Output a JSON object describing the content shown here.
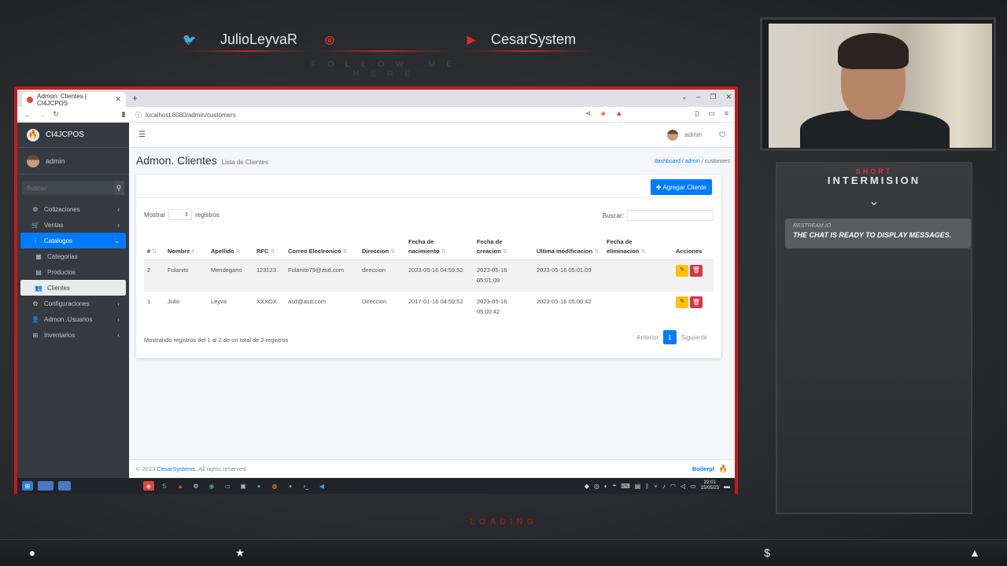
{
  "overlay": {
    "social": [
      {
        "icon": "twitter-icon",
        "handle": "JulioLeyvaR"
      },
      {
        "icon": "instagram-icon",
        "handle": ""
      },
      {
        "icon": "youtube-icon",
        "handle": "CesarSystem"
      }
    ],
    "follow_text": "FOLLOW ME HERE",
    "chat": {
      "title_small": "SHORT",
      "title": "INTERMISION",
      "user": "RESTREAM.IO",
      "message": "THE CHAT IS READY TO DISPLAY MESSAGES."
    },
    "loading_text": "LOADING"
  },
  "browser": {
    "tab_title": "Admon. Clientes | CI4JCPOS",
    "url": "localhost:8080/admin/customers"
  },
  "app": {
    "brand": "CI4JCPOS",
    "user": "admin",
    "sidebar_search_placeholder": "Buscar",
    "menu": [
      {
        "label": "Cotizaciones",
        "icon": "calculator-icon",
        "arrow": "‹"
      },
      {
        "label": "Ventas",
        "icon": "cart-icon",
        "arrow": "‹"
      },
      {
        "label": "Catalogos",
        "icon": "list-icon",
        "arrow": "⌄",
        "active": true
      },
      {
        "label": "Categorias",
        "icon": "grid-icon",
        "sub": true
      },
      {
        "label": "Productos",
        "icon": "boxes-icon",
        "sub": true
      },
      {
        "label": "Clientes",
        "icon": "users-icon",
        "sub": true,
        "subactive": true
      },
      {
        "label": "Configuraciones",
        "icon": "gears-icon",
        "arrow": "‹"
      },
      {
        "label": "Admon .Usuarios",
        "icon": "user-icon",
        "arrow": "‹"
      },
      {
        "label": "Inventarios",
        "icon": "sitemap-icon",
        "arrow": "‹"
      }
    ],
    "topnav_user": "admin",
    "page_title": "Admon. Clientes",
    "page_subtitle": "Lista de Clientes",
    "breadcrumb": [
      "dashboard",
      "admin",
      "customers"
    ],
    "add_button": "Agregar Cliente",
    "show_label": "Mostrar",
    "records_label": "registros",
    "search_label": "Buscar:",
    "columns": [
      "#",
      "Nombre",
      "Apellido",
      "RFC",
      "Correo Electronico",
      "Direccion",
      "Fecha de nacimiento",
      "Fecha de creacion",
      "Ultima modificacion",
      "Fecha de eliminacion",
      "Acciones"
    ],
    "rows": [
      {
        "id": "2",
        "nombre": "Fulanito",
        "apellido": "Mendegano",
        "rfc": "123123",
        "correo": "Fulanito79@asd.com",
        "direccion": "direccion",
        "nacimiento": "2023-05-16 04:59:52",
        "creacion": "2023-05-16 05:01:09",
        "modificacion": "2023-05-16 05:01:09",
        "eliminacion": ""
      },
      {
        "id": "1",
        "nombre": "Julio",
        "apellido": "Leyva",
        "rfc": "XXXOX",
        "correo": "asd@asd.com",
        "direccion": "Direccion",
        "nacimiento": "2017-01-16 04:59:52",
        "creacion": "2023-05-16 05:00:42",
        "modificacion": "2023-05-16 05:00:42",
        "eliminacion": ""
      }
    ],
    "info_text": "Mostrando registros del 1 al 2 de un total de 2 registros",
    "pager": {
      "prev": "Anterior",
      "current": "1",
      "next": "Siguiente"
    },
    "footer_prefix": "© 2023",
    "footer_link": "CesarSystems.",
    "footer_suffix": "All rights reserved.",
    "footer_right": "Boilerpl"
  },
  "taskbar": {
    "time": "22:01",
    "date": "15/05/23"
  }
}
